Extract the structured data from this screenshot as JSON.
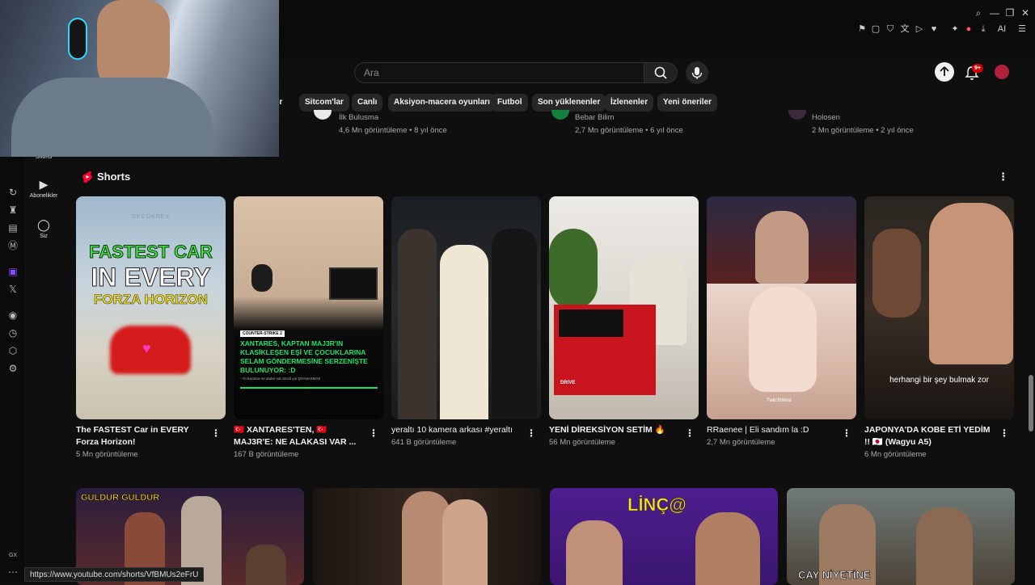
{
  "browser": {
    "window_controls": [
      "search-icon",
      "minimize-icon",
      "restore-icon",
      "close-icon"
    ],
    "extensions": [
      "bookmark-icon",
      "snapshot-icon",
      "shield-icon",
      "translate-icon",
      "send-icon",
      "play-icon",
      "heart-icon",
      "extensions-icon",
      "profile-icon",
      "download-icon"
    ],
    "ai_label": "AI"
  },
  "search": {
    "placeholder": "Ara"
  },
  "notifications": {
    "badge": "9+"
  },
  "chips": [
    {
      "label": "er"
    },
    {
      "label": "Sitcom'lar"
    },
    {
      "label": "Canlı"
    },
    {
      "label": "Aksiyon-macera oyunları"
    },
    {
      "label": "Futbol"
    },
    {
      "label": "Son yüklenenler"
    },
    {
      "label": "İzlenenler"
    },
    {
      "label": "Yeni öneriler"
    }
  ],
  "previous_row": [
    {
      "channel": "İlk Buluşma",
      "meta": "4,6 Mn görüntüleme • 8 yıl önce"
    },
    {
      "channel": "Bebar Bilim",
      "meta": "2,7 Mn görüntüleme • 6 yıl önce"
    },
    {
      "channel": "Holosen",
      "meta": "2 Mn görüntüleme • 2 yıl önce"
    }
  ],
  "guide": {
    "shorts_label": "Shorts",
    "subscriptions_label": "Abonelikler",
    "you_label": "Siz"
  },
  "gx_label": "GX",
  "shorts_section": {
    "title": "Shorts",
    "items": [
      {
        "title": "The FASTEST Car in EVERY Forza Horizon!",
        "views": "5 Mn görüntüleme",
        "thumb_text_1": "FASTEST CAR",
        "thumb_text_2": "IN EVERY",
        "thumb_text_3": "FORZA HORIZON",
        "thumb_logo": "DECOKNEX"
      },
      {
        "title": "🇹🇷 XANTARES'TEN, 🇹🇷 MAJ3R'E: NE ALAKASI VAR ...",
        "views": "167 B görüntüleme",
        "thumb_tag": "COUNTER-STRIKE 2",
        "thumb_text": "XANTARES, KAPTAN MAJ3R'IN KLASİKLEŞEN EŞİ VE ÇOCUKLARINA SELAM GÖNDERMESİNE SERZENİŞTE BULUNUYOR: :D",
        "thumb_caption": "- Yo kaciana ne alaksi var ancid yai ŞRANASMA5"
      },
      {
        "title": "yeraltı 10 kamera arkası  #yeraltı",
        "views": "641 B görüntüleme"
      },
      {
        "title": "YENİ DİREKSİYON SETİM 🔥",
        "views": "56 Mn görüntüleme",
        "thumb_box": "DRIVE"
      },
      {
        "title": "RRaenee | Eli sandım la :D",
        "views": "2,7 Mn görüntüleme",
        "thumb_caption": "TwitchWest"
      },
      {
        "title": "JAPONYA'DA KOBE ETİ YEDİM !! 🇯🇵 (Wagyu A5)",
        "views": "6 Mn görüntüleme",
        "thumb_caption": "herhangi bir şey bulmak zor"
      }
    ]
  },
  "bottom_row": [
    {
      "thumb_text": "GÜLDÜR GÜLDÜR"
    },
    {
      "thumb_text": ""
    },
    {
      "thumb_text": "LİNÇ@"
    },
    {
      "thumb_text": "ÇAY NİYETİNE"
    }
  ],
  "status_url": "https://www.youtube.com/shorts/VfBMUs2eFrU",
  "colors": {
    "background": "#0f0f0f",
    "shorts_red": "#ff0033",
    "chip_bg": "#272727",
    "forza_green": "#45e34a",
    "cs_green": "#21e06a",
    "twitch_purple": "#9146ff"
  }
}
